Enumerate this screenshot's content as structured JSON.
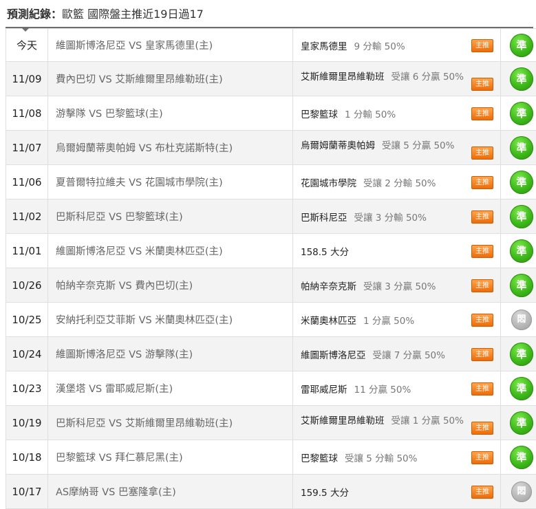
{
  "header": {
    "label": "預測紀錄：",
    "title": "歐籃 國際盤主推近19日過17"
  },
  "rows": [
    {
      "date": "今天",
      "match": "維圖斯博洛尼亞 VS 皇家馬德里(主)",
      "team": "皇家馬德里",
      "info": "9 分輸 50%",
      "badge": "主推",
      "result": "準",
      "result_type": "win",
      "two_line": false
    },
    {
      "date": "11/09",
      "match": "費內巴切 VS 艾斯維爾里昂維勒班(主)",
      "team": "艾斯維爾里昂維勒班",
      "info": "受讓 6 分贏 50%",
      "badge": "主推",
      "result": "準",
      "result_type": "win",
      "two_line": true
    },
    {
      "date": "11/08",
      "match": "游擊隊 VS 巴黎籃球(主)",
      "team": "巴黎籃球",
      "info": "1 分輸 50%",
      "badge": "主推",
      "result": "準",
      "result_type": "win",
      "two_line": false
    },
    {
      "date": "11/07",
      "match": "烏爾姆蘭蒂奧帕姆 VS 布杜克諾斯特(主)",
      "team": "烏爾姆蘭蒂奧帕姆",
      "info": "受讓 5 分贏 50%",
      "badge": "主推",
      "result": "準",
      "result_type": "win",
      "two_line": true
    },
    {
      "date": "11/06",
      "match": "夏普爾特拉維夫 VS 花園城市學院(主)",
      "team": "花園城市學院",
      "info": "受讓 2 分輸 50%",
      "badge": "主推",
      "result": "準",
      "result_type": "win",
      "two_line": false
    },
    {
      "date": "11/02",
      "match": "巴斯科尼亞 VS 巴黎籃球(主)",
      "team": "巴斯科尼亞",
      "info": "受讓 3 分輸 50%",
      "badge": "主推",
      "result": "準",
      "result_type": "win",
      "two_line": false
    },
    {
      "date": "11/01",
      "match": "維圖斯博洛尼亞 VS 米蘭奧林匹亞(主)",
      "team": "158.5 大分",
      "info": "",
      "badge": "主推",
      "result": "準",
      "result_type": "win",
      "two_line": false
    },
    {
      "date": "10/26",
      "match": "帕納辛奈克斯 VS 費內巴切(主)",
      "team": "帕納辛奈克斯",
      "info": "受讓 3 分贏 50%",
      "badge": "主推",
      "result": "準",
      "result_type": "win",
      "two_line": false
    },
    {
      "date": "10/25",
      "match": "安納托利亞艾菲斯 VS 米蘭奧林匹亞(主)",
      "team": "米蘭奧林匹亞",
      "info": "1 分贏 50%",
      "badge": "主推",
      "result": "悶",
      "result_type": "push",
      "two_line": false
    },
    {
      "date": "10/24",
      "match": "維圖斯博洛尼亞 VS 游擊隊(主)",
      "team": "維圖斯博洛尼亞",
      "info": "受讓 7 分贏 50%",
      "badge": "主推",
      "result": "準",
      "result_type": "win",
      "two_line": false
    },
    {
      "date": "10/23",
      "match": "漢堡塔 VS 雷耶威尼斯(主)",
      "team": "雷耶威尼斯",
      "info": "11 分贏 50%",
      "badge": "主推",
      "result": "準",
      "result_type": "win",
      "two_line": false
    },
    {
      "date": "10/19",
      "match": "巴斯科尼亞 VS 艾斯維爾里昂維勒班(主)",
      "team": "艾斯維爾里昂維勒班",
      "info": "受讓 1 分贏 50%",
      "badge": "主推",
      "result": "準",
      "result_type": "win",
      "two_line": true
    },
    {
      "date": "10/18",
      "match": "巴黎籃球 VS 拜仁慕尼黑(主)",
      "team": "巴黎籃球",
      "info": "受讓 5 分輸 50%",
      "badge": "主推",
      "result": "準",
      "result_type": "win",
      "two_line": false
    },
    {
      "date": "10/17",
      "match": "AS摩納哥 VS 巴塞隆拿(主)",
      "team": "159.5 大分",
      "info": "",
      "badge": "主推",
      "result": "悶",
      "result_type": "push",
      "two_line": false
    }
  ]
}
